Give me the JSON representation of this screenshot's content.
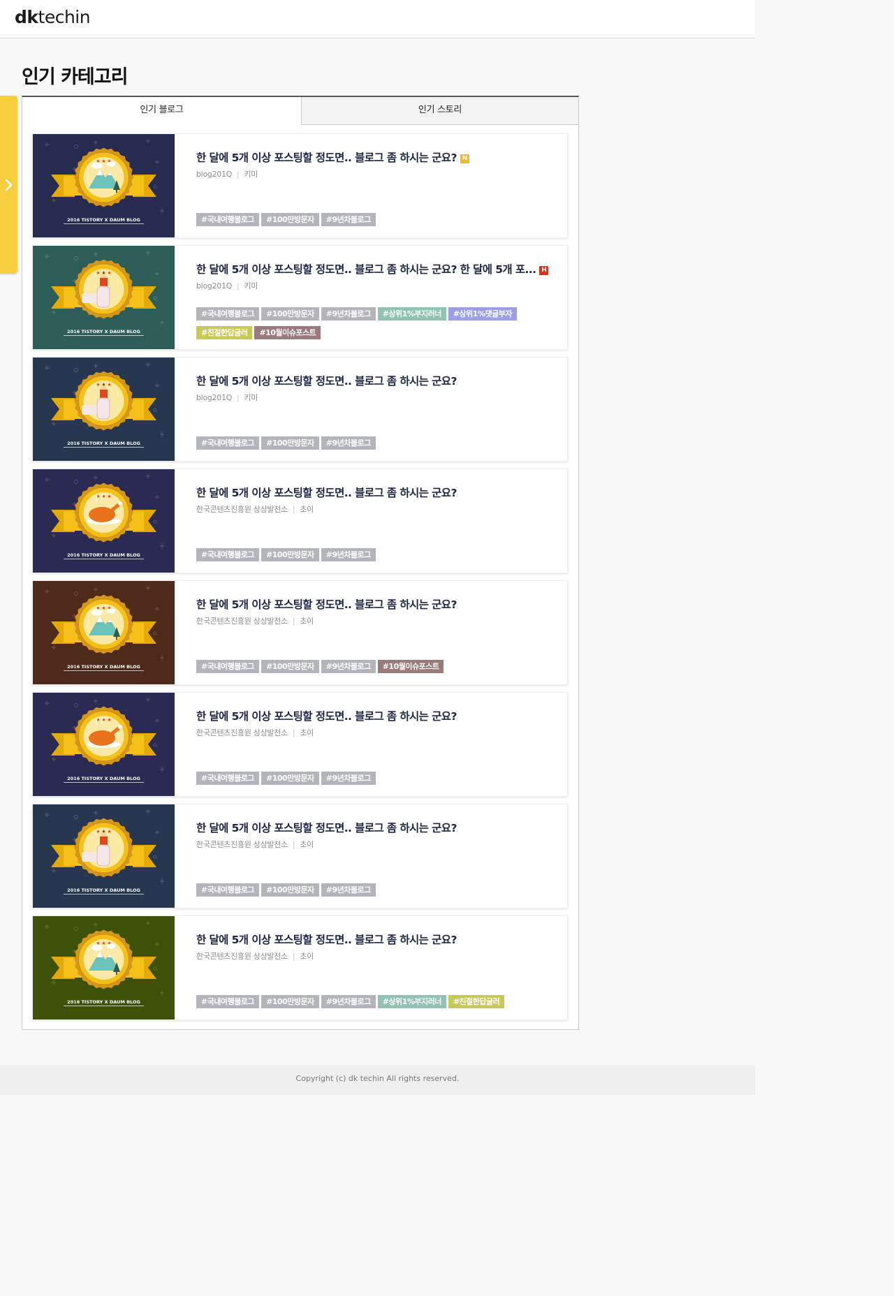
{
  "header": {
    "logo_bold": "dk",
    "logo_light": "techin"
  },
  "page": {
    "title": "인기 카테고리"
  },
  "tabs": [
    {
      "label": "인기 블로그",
      "active": true
    },
    {
      "label": "인기 스토리",
      "active": false
    }
  ],
  "colors": {
    "accent_yellow": "#f7cf3e",
    "tag_gray": "#b3b5bb",
    "tag_teal": "#92c2b4",
    "tag_lavender": "#9d9fe6",
    "tag_olive": "#c9c95a",
    "tag_mauve": "#9a7a7a",
    "badge_new": "#f0b92a",
    "badge_hot": "#d0371e"
  },
  "cards": [
    {
      "title": "한 달에 5개 이상 포스팅할 정도면.. 블로그 좀 하시는 군요?",
      "badge": "N",
      "badge_color": "#f0b92a",
      "blog": "blog201Q",
      "author": "키미",
      "thumb": {
        "bg": "#262b4f",
        "icon": "mountain-icon",
        "caption": "2016 TISTORY X DAUM BLOG"
      },
      "tags": [
        {
          "label": "#국내여행블로그",
          "color": "#b3b5bb"
        },
        {
          "label": "#100만방문자",
          "color": "#b3b5bb"
        },
        {
          "label": "#9년차블로그",
          "color": "#b3b5bb"
        }
      ]
    },
    {
      "title": "한 달에 5개 이상 포스팅할 정도면.. 블로그 좀 하시는 군요? 한 달에 5개 포...",
      "badge": "H",
      "badge_color": "#d0371e",
      "blog": "blog201Q",
      "author": "키미",
      "thumb": {
        "bg": "#2c5e57",
        "icon": "pencil-hand-icon",
        "caption": "2016 TISTORY X DAUM BLOG"
      },
      "tags": [
        {
          "label": "#국내여행블로그",
          "color": "#b3b5bb"
        },
        {
          "label": "#100만방문자",
          "color": "#b3b5bb"
        },
        {
          "label": "#9년차블로그",
          "color": "#b3b5bb"
        },
        {
          "label": "#상위1%부지러너",
          "color": "#92c2b4"
        },
        {
          "label": "#상위1%댓글부자",
          "color": "#9d9fe6"
        },
        {
          "label": "#친절한답글러",
          "color": "#c9c95a"
        },
        {
          "label": "#10월이슈포스트",
          "color": "#9a7a7a"
        }
      ]
    },
    {
      "title": "한 달에 5개 이상 포스팅할 정도면.. 블로그 좀 하시는 군요?",
      "badge": "",
      "badge_color": "",
      "blog": "blog201Q",
      "author": "키미",
      "thumb": {
        "bg": "#27374f",
        "icon": "pencil-hand-icon",
        "caption": "2016 TISTORY X DAUM BLOG"
      },
      "tags": [
        {
          "label": "#국내여행블로그",
          "color": "#b3b5bb"
        },
        {
          "label": "#100만방문자",
          "color": "#b3b5bb"
        },
        {
          "label": "#9년차블로그",
          "color": "#b3b5bb"
        }
      ]
    },
    {
      "title": "한 달에 5개 이상 포스팅할 정도면.. 블로그 좀 하시는 군요?",
      "badge": "",
      "badge_color": "",
      "blog": "한국콘텐츠진흥원 상상발전소",
      "author": "초이",
      "thumb": {
        "bg": "#2a2a52",
        "icon": "roast-chicken-icon",
        "caption": "2016 TISTORY X DAUM BLOG"
      },
      "tags": [
        {
          "label": "#국내여행블로그",
          "color": "#b3b5bb"
        },
        {
          "label": "#100만방문자",
          "color": "#b3b5bb"
        },
        {
          "label": "#9년차블로그",
          "color": "#b3b5bb"
        }
      ]
    },
    {
      "title": "한 달에 5개 이상 포스팅할 정도면.. 블로그 좀 하시는 군요?",
      "badge": "",
      "badge_color": "",
      "blog": "한국콘텐츠진흥원 상상발전소",
      "author": "초이",
      "thumb": {
        "bg": "#4e2a1a",
        "icon": "mountain-icon",
        "caption": "2016 TISTORY X DAUM BLOG"
      },
      "tags": [
        {
          "label": "#국내여행블로그",
          "color": "#b3b5bb"
        },
        {
          "label": "#100만방문자",
          "color": "#b3b5bb"
        },
        {
          "label": "#9년차블로그",
          "color": "#b3b5bb"
        },
        {
          "label": "#10월이슈포스트",
          "color": "#9a7a7a"
        }
      ]
    },
    {
      "title": "한 달에 5개 이상 포스팅할 정도면.. 블로그 좀 하시는 군요?",
      "badge": "",
      "badge_color": "",
      "blog": "한국콘텐츠진흥원 상상발전소",
      "author": "초이",
      "thumb": {
        "bg": "#2a2a52",
        "icon": "roast-chicken-icon",
        "caption": "2016 TISTORY X DAUM BLOG"
      },
      "tags": [
        {
          "label": "#국내여행블로그",
          "color": "#b3b5bb"
        },
        {
          "label": "#100만방문자",
          "color": "#b3b5bb"
        },
        {
          "label": "#9년차블로그",
          "color": "#b3b5bb"
        }
      ]
    },
    {
      "title": "한 달에 5개 이상 포스팅할 정도면.. 블로그 좀 하시는 군요?",
      "badge": "",
      "badge_color": "",
      "blog": "한국콘텐츠진흥원 상상발전소",
      "author": "초이",
      "thumb": {
        "bg": "#27374f",
        "icon": "pencil-hand-icon",
        "caption": "2016 TISTORY X DAUM BLOG"
      },
      "tags": [
        {
          "label": "#국내여행블로그",
          "color": "#b3b5bb"
        },
        {
          "label": "#100만방문자",
          "color": "#b3b5bb"
        },
        {
          "label": "#9년차블로그",
          "color": "#b3b5bb"
        }
      ]
    },
    {
      "title": "한 달에 5개 이상 포스팅할 정도면.. 블로그 좀 하시는 군요?",
      "badge": "",
      "badge_color": "",
      "blog": "한국콘텐츠진흥원 상상발전소",
      "author": "초이",
      "thumb": {
        "bg": "#3d5208",
        "icon": "mountain-icon",
        "caption": "2016 TISTORY X DAUM BLOG"
      },
      "tags": [
        {
          "label": "#국내여행블로그",
          "color": "#b3b5bb"
        },
        {
          "label": "#100만방문자",
          "color": "#b3b5bb"
        },
        {
          "label": "#9년차블로그",
          "color": "#b3b5bb"
        },
        {
          "label": "#상위1%부지러너",
          "color": "#92c2b4"
        },
        {
          "label": "#친절한답글러",
          "color": "#c9c95a"
        }
      ]
    }
  ],
  "footer": {
    "copyright": "Copyright (c) dk techin All rights reserved."
  }
}
